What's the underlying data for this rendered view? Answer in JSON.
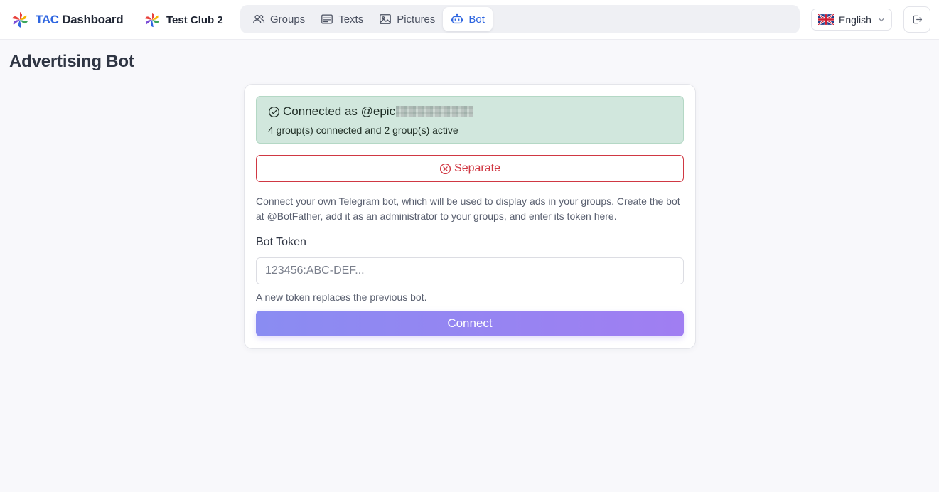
{
  "brand": {
    "accent": "TAC",
    "rest": " Dashboard",
    "icon": "pinwheel-logo-icon"
  },
  "club": {
    "name": "Test Club 2",
    "icon": "pinwheel-logo-icon"
  },
  "nav": {
    "tabs": [
      {
        "label": "Groups",
        "icon": "users-icon",
        "active": false
      },
      {
        "label": "Texts",
        "icon": "text-lines-icon",
        "active": false
      },
      {
        "label": "Pictures",
        "icon": "image-icon",
        "active": false
      },
      {
        "label": "Bot",
        "icon": "robot-icon",
        "active": true
      }
    ]
  },
  "language": {
    "label": "English",
    "flag": "uk-flag-icon"
  },
  "logout": {
    "icon": "logout-icon"
  },
  "page": {
    "title": "Advertising Bot"
  },
  "card": {
    "status": {
      "connected_prefix": "Connected as @epic",
      "summary": "4 group(s) connected and 2 group(s) active"
    },
    "separate_label": "Separate",
    "description": "Connect your own Telegram bot, which will be used to display ads in your groups. Create the bot at @BotFather, add it as an administrator to your groups, and enter its token here.",
    "token_label": "Bot Token",
    "token_placeholder": "123456:ABC-DEF...",
    "token_value": "",
    "hint": "A new token replaces the previous bot.",
    "connect_label": "Connect"
  },
  "colors": {
    "accent": "#2f66e0",
    "success_bg": "#d1e7dd",
    "danger": "#d03843",
    "connect_gradient_start": "#8a8cf2",
    "connect_gradient_end": "#a07ef2"
  }
}
